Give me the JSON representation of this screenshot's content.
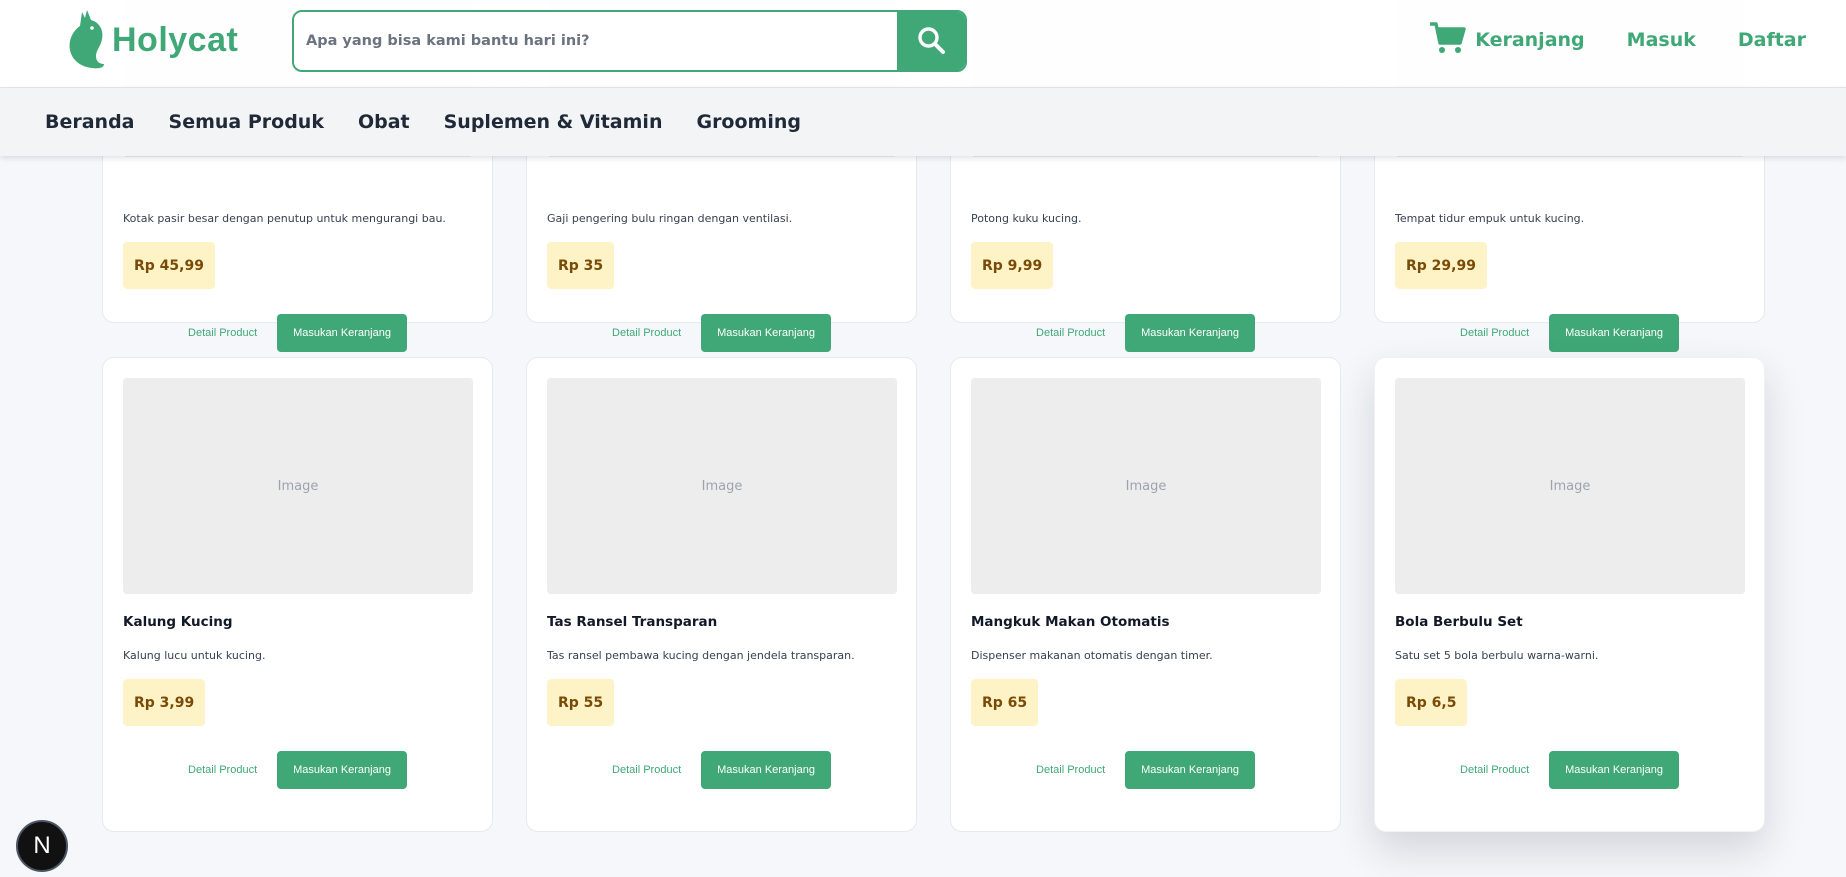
{
  "brand": {
    "name": "Holycat",
    "color": "#3fa876"
  },
  "search": {
    "placeholder": "Apa yang bisa kami bantu hari ini?",
    "icon": "search-icon"
  },
  "nav": {
    "cart_label": "Keranjang",
    "login_label": "Masuk",
    "register_label": "Daftar"
  },
  "categories": [
    "Beranda",
    "Semua Produk",
    "Obat",
    "Suplemen & Vitamin",
    "Grooming"
  ],
  "products_row1": [
    {
      "price": "Rp 45,99"
    },
    {
      "price": "Rp 35"
    },
    {
      "price": "Rp 9,99"
    },
    {
      "price": "Rp 29,99"
    }
  ],
  "products_row2": [
    {
      "image_label": "Image",
      "name": "Kalung Kucing",
      "description": "Kalung lucu untuk kucing.",
      "price": "Rp 3,99"
    },
    {
      "image_label": "Image",
      "name": "Tas Ransel Transparan",
      "description": "Tas ransel pembawa kucing dengan jendela transparan.",
      "price": "Rp 55"
    },
    {
      "image_label": "Image",
      "name": "Mangkuk Makan Otomatis",
      "description": "Dispenser makanan otomatis dengan timer.",
      "price": "Rp 65"
    },
    {
      "image_label": "Image",
      "name": "Bola Berbulu Set",
      "description": "Satu set 5 bola berbulu warna-warni.",
      "price": "Rp 6,5"
    }
  ],
  "card_actions": {
    "detail_label": "Detail Product",
    "add_label": "Masukan Keranjang"
  },
  "dev_badge": {
    "letter": "N"
  },
  "colors": {
    "accent": "#3fa876",
    "price_bg": "#fef3c7",
    "price_text": "#7a4a07"
  }
}
